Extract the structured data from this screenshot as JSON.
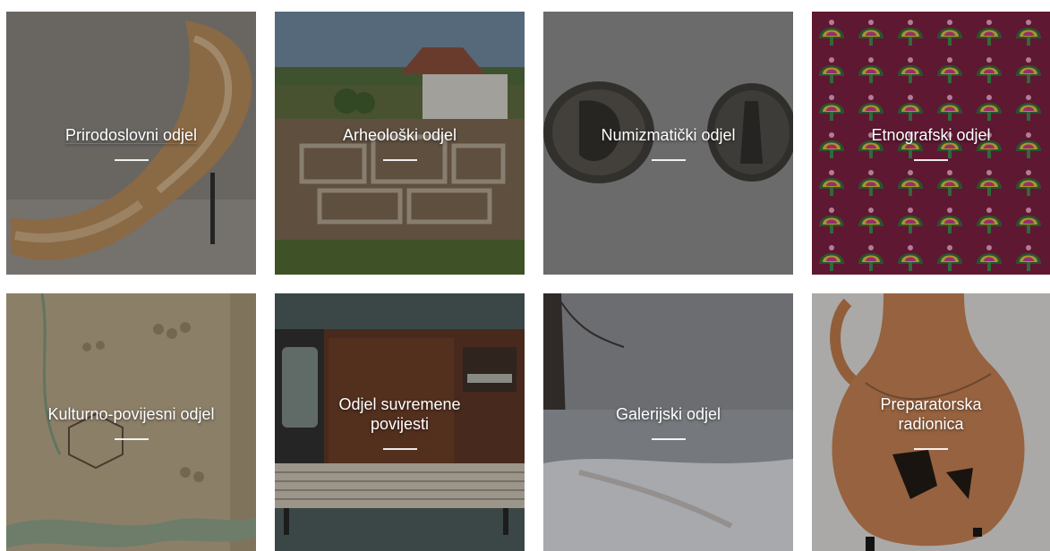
{
  "tiles": [
    {
      "title": "Prirodoslovni odjel"
    },
    {
      "title": "Arheološki odjel"
    },
    {
      "title": "Numizmatički odjel"
    },
    {
      "title": "Etnografski odjel"
    },
    {
      "title": "Kulturno-povijesni odjel"
    },
    {
      "title": "Odjel suvremene povijesti"
    },
    {
      "title": "Galerijski odjel"
    },
    {
      "title": "Preparatorska radionica"
    }
  ],
  "colors": {
    "overlay_text": "#ffffff",
    "link_underline": "#3b82c4"
  }
}
